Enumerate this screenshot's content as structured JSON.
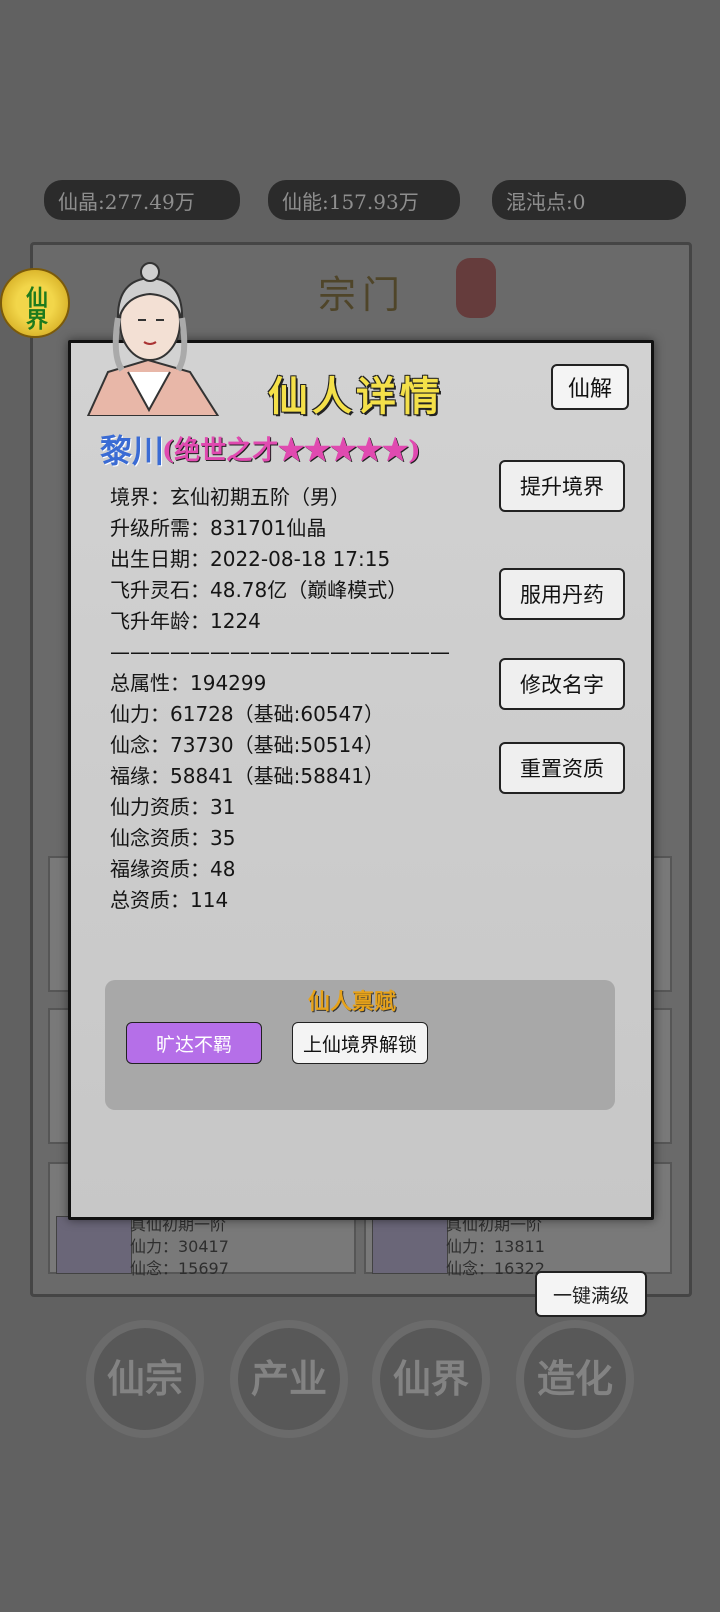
{
  "resources": [
    {
      "label": "仙晶:277.49万"
    },
    {
      "label": "仙能:157.93万"
    },
    {
      "label": "混沌点:0"
    }
  ],
  "sect": {
    "title": "宗门",
    "xianjie_badge": "仙界"
  },
  "bg_cards": [
    {
      "realm": "真仙初期一阶",
      "power": "仙力：30417",
      "mind": "仙念：15697"
    },
    {
      "realm": "真仙初期一阶",
      "power": "仙力：13811",
      "mind": "仙念：16322"
    }
  ],
  "max_button": "一键满级",
  "nav": [
    {
      "label": "仙宗"
    },
    {
      "label": "产业"
    },
    {
      "label": "仙界"
    },
    {
      "label": "造化"
    }
  ],
  "modal": {
    "title": "仙人详情",
    "dismiss_label": "仙解",
    "name": "黎川",
    "grade": "(绝世之才★★★★★)",
    "stats": [
      "境界：玄仙初期五阶（男）",
      "升级所需：831701仙晶",
      "出生日期：2022-08-18 17:15",
      "飞升灵石：48.78亿（巅峰模式）",
      "飞升年龄：1224",
      "—————————————————",
      "总属性：194299",
      "仙力：61728（基础:60547）",
      "仙念：73730（基础:50514）",
      "福缘：58841（基础:58841）",
      "仙力资质：31",
      "仙念资质：35",
      "福缘资质：48",
      "总资质：114"
    ],
    "actions": [
      {
        "label": "提升境界"
      },
      {
        "label": "服用丹药"
      },
      {
        "label": "修改名字"
      },
      {
        "label": "重置资质"
      }
    ],
    "talent": {
      "title": "仙人禀赋",
      "items": [
        {
          "label": "旷达不羁",
          "color": "#b56fe8"
        },
        {
          "label": "上仙境界解锁",
          "color": "#f4f4f4"
        }
      ]
    }
  }
}
